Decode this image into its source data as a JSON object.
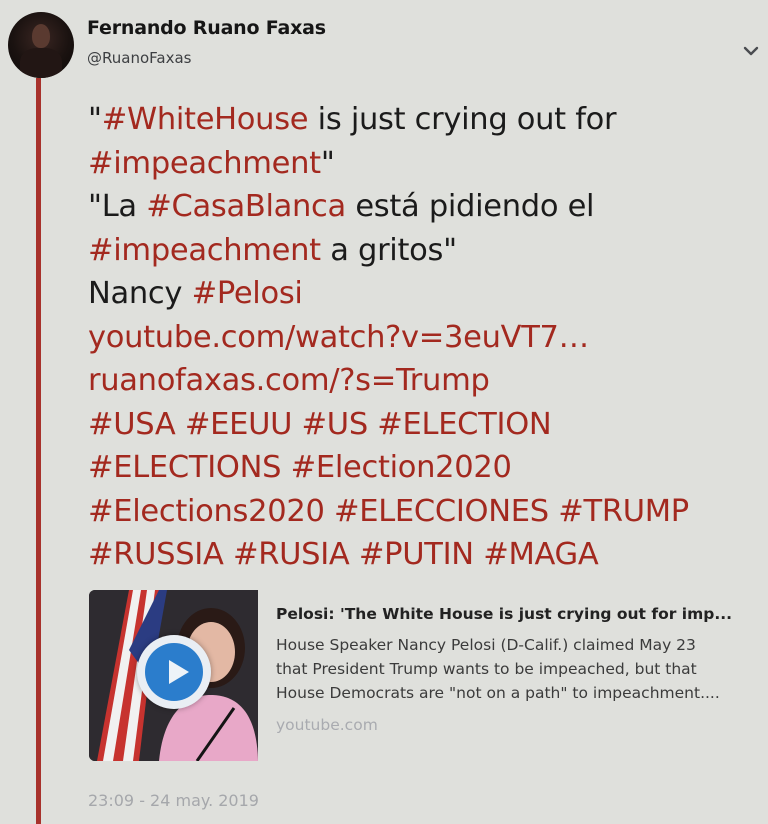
{
  "user": {
    "display_name": "Fernando Ruano Faxas",
    "handle": "@RuanoFaxas"
  },
  "menu_icon": "chevron-down-icon",
  "tweet": {
    "lines": [
      [
        {
          "t": "text",
          "v": "\""
        },
        {
          "t": "hashtag",
          "v": "#WhiteHouse"
        },
        {
          "t": "text",
          "v": " is just crying out for"
        }
      ],
      [
        {
          "t": "hashtag",
          "v": "#impeachment"
        },
        {
          "t": "text",
          "v": "\""
        }
      ],
      [
        {
          "t": "text",
          "v": "\"La "
        },
        {
          "t": "hashtag",
          "v": "#CasaBlanca"
        },
        {
          "t": "text",
          "v": " está pidiendo el"
        }
      ],
      [
        {
          "t": "hashtag",
          "v": "#impeachment"
        },
        {
          "t": "text",
          "v": " a gritos\""
        }
      ],
      [
        {
          "t": "text",
          "v": "Nancy "
        },
        {
          "t": "hashtag",
          "v": "#Pelosi"
        }
      ],
      [
        {
          "t": "link",
          "v": "youtube.com/watch?v=3euVT7…"
        }
      ],
      [
        {
          "t": "link",
          "v": "ruanofaxas.com/?s=Trump"
        }
      ],
      [
        {
          "t": "hashtag",
          "v": "#USA"
        },
        {
          "t": "text",
          "v": " "
        },
        {
          "t": "hashtag",
          "v": "#EEUU"
        },
        {
          "t": "text",
          "v": " "
        },
        {
          "t": "hashtag",
          "v": "#US"
        },
        {
          "t": "text",
          "v": " "
        },
        {
          "t": "hashtag",
          "v": "#ELECTION"
        }
      ],
      [
        {
          "t": "hashtag",
          "v": "#ELECTIONS"
        },
        {
          "t": "text",
          "v": " "
        },
        {
          "t": "hashtag",
          "v": "#Election2020"
        }
      ],
      [
        {
          "t": "hashtag",
          "v": "#Elections2020"
        },
        {
          "t": "text",
          "v": " "
        },
        {
          "t": "hashtag",
          "v": "#ELECCIONES"
        },
        {
          "t": "text",
          "v": " "
        },
        {
          "t": "hashtag",
          "v": "#TRUMP"
        }
      ],
      [
        {
          "t": "hashtag",
          "v": "#RUSSIA"
        },
        {
          "t": "text",
          "v": " "
        },
        {
          "t": "hashtag",
          "v": "#RUSIA"
        },
        {
          "t": "text",
          "v": " "
        },
        {
          "t": "hashtag",
          "v": "#PUTIN"
        },
        {
          "t": "text",
          "v": " "
        },
        {
          "t": "hashtag",
          "v": "#MAGA"
        }
      ]
    ]
  },
  "card": {
    "title": "Pelosi: 'The White House is just crying out for imp...",
    "description_lines": [
      "House Speaker Nancy Pelosi (D-Calif.) claimed May 23",
      "that President Trump wants to be impeached, but that",
      "House Democrats are \"not on a path\" to impeachment...."
    ],
    "domain": "youtube.com",
    "play_icon": "play-icon"
  },
  "timestamp": "23:09 - 24 may. 2019",
  "colors": {
    "background": "#dfe0dc",
    "hashtag": "#a3291f",
    "thread_line": "#a8322c",
    "play_button": "#2b7dcc"
  }
}
